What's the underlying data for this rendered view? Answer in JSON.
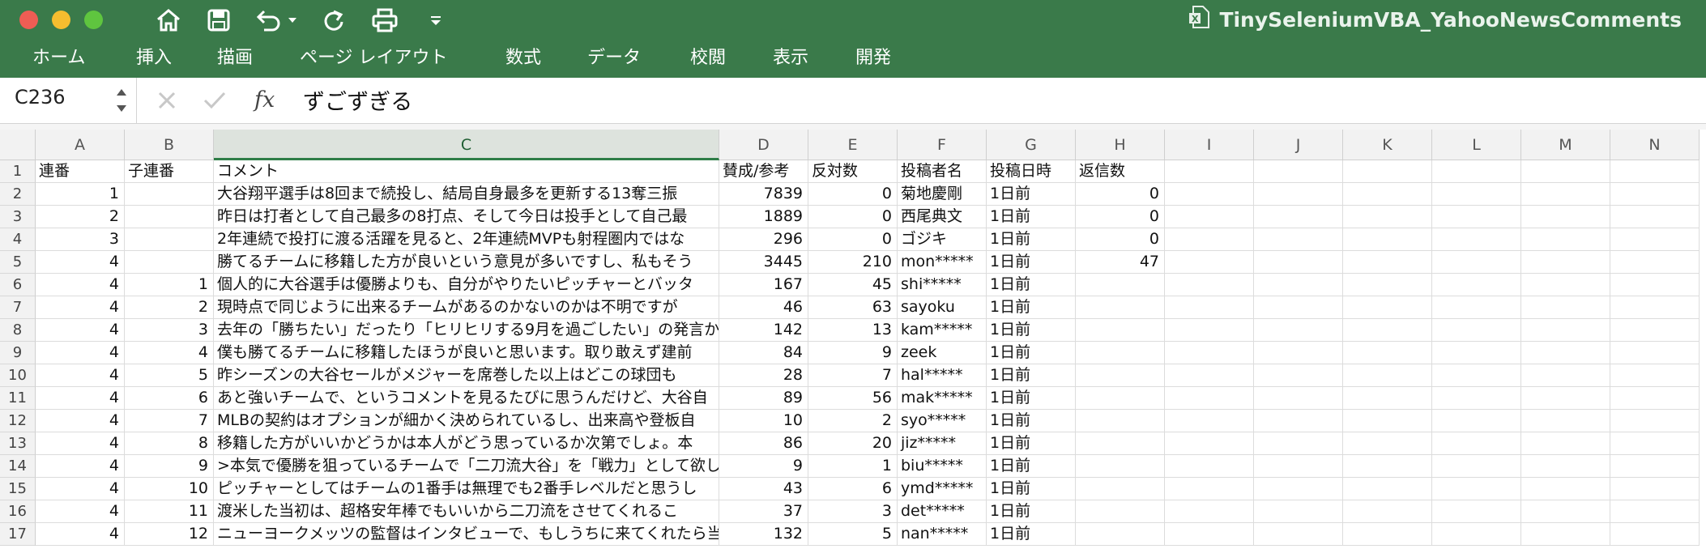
{
  "window": {
    "title": "TinySeleniumVBA_YahooNewsComments"
  },
  "colors": {
    "titlebar": "#3a7a4a",
    "close": "#ee5d54",
    "minimize": "#f5bd2f",
    "zoom": "#5fc53f",
    "selected_header": "#2e7d47"
  },
  "toolbar_icons": [
    "home-icon",
    "save-icon",
    "undo-icon",
    "redo-icon",
    "print-icon",
    "customize-dropdown-icon"
  ],
  "ribbon": {
    "tabs": [
      "ホーム",
      "挿入",
      "描画",
      "ページ レイアウト",
      "数式",
      "データ",
      "校閲",
      "表示",
      "開発"
    ]
  },
  "formula_bar": {
    "cell_ref": "C236",
    "fx": "fx",
    "content": "ずごずぎる"
  },
  "sheet": {
    "columns": [
      "A",
      "B",
      "C",
      "D",
      "E",
      "F",
      "G",
      "H",
      "I",
      "J",
      "K",
      "L",
      "M",
      "N"
    ],
    "selected_column": "C",
    "header_row": [
      "連番",
      "子連番",
      "コメント",
      "賛成/参考",
      "反対数",
      "投稿者名",
      "投稿日時",
      "返信数"
    ],
    "rows": [
      {
        "n": "2",
        "a": "1",
        "b": "",
        "c": "大谷翔平選手は8回まで続投し、結局自身最多を更新する13奪三振",
        "d": "7839",
        "e": "0",
        "f": "菊地慶剛",
        "g": "1日前",
        "h": "0"
      },
      {
        "n": "3",
        "a": "2",
        "b": "",
        "c": "昨日は打者として自己最多の8打点、そして今日は投手として自己最",
        "d": "1889",
        "e": "0",
        "f": "西尾典文",
        "g": "1日前",
        "h": "0"
      },
      {
        "n": "4",
        "a": "3",
        "b": "",
        "c": "2年連続で投打に渡る活躍を見ると、2年連続MVPも射程圏内ではな",
        "d": "296",
        "e": "0",
        "f": "ゴジキ",
        "g": "1日前",
        "h": "0"
      },
      {
        "n": "5",
        "a": "4",
        "b": "",
        "c": "勝てるチームに移籍した方が良いという意見が多いですし、私もそう",
        "d": "3445",
        "e": "210",
        "f": "mon*****",
        "g": "1日前",
        "h": "47"
      },
      {
        "n": "6",
        "a": "4",
        "b": "1",
        "c": "個人的に大谷選手は優勝よりも、自分がやりたいピッチャーとバッタ",
        "d": "167",
        "e": "45",
        "f": "shi*****",
        "g": "1日前",
        "h": ""
      },
      {
        "n": "7",
        "a": "4",
        "b": "2",
        "c": "現時点で同じように出来るチームがあるのかないのかは不明ですが",
        "d": "46",
        "e": "63",
        "f": "sayoku",
        "g": "1日前",
        "h": ""
      },
      {
        "n": "8",
        "a": "4",
        "b": "3",
        "c": "去年の「勝ちたい」だったり「ヒリヒリする9月を過ごしたい」の発言から",
        "d": "142",
        "e": "13",
        "f": "kam*****",
        "g": "1日前",
        "h": ""
      },
      {
        "n": "9",
        "a": "4",
        "b": "4",
        "c": "僕も勝てるチームに移籍したほうが良いと思います。取り敢えず建前",
        "d": "84",
        "e": "9",
        "f": "zeek",
        "g": "1日前",
        "h": ""
      },
      {
        "n": "10",
        "a": "4",
        "b": "5",
        "c": "昨シーズンの大谷セールがメジャーを席巻した以上はどこの球団も",
        "d": "28",
        "e": "7",
        "f": "hal*****",
        "g": "1日前",
        "h": ""
      },
      {
        "n": "11",
        "a": "4",
        "b": "6",
        "c": "あと強いチームで、というコメントを見るたびに思うんだけど、大谷自",
        "d": "89",
        "e": "56",
        "f": "mak*****",
        "g": "1日前",
        "h": ""
      },
      {
        "n": "12",
        "a": "4",
        "b": "7",
        "c": "MLBの契約はオプションが細かく決められているし、出来高や登板自",
        "d": "10",
        "e": "2",
        "f": "syo*****",
        "g": "1日前",
        "h": ""
      },
      {
        "n": "13",
        "a": "4",
        "b": "8",
        "c": "移籍した方がいいかどうかは本人がどう思っているか次第でしょ。本",
        "d": "86",
        "e": "20",
        "f": "jiz*****",
        "g": "1日前",
        "h": ""
      },
      {
        "n": "14",
        "a": "4",
        "b": "9",
        "c": ">本気で優勝を狙っているチームで「二刀流大谷」を「戦力」として欲し",
        "d": "9",
        "e": "1",
        "f": "biu*****",
        "g": "1日前",
        "h": ""
      },
      {
        "n": "15",
        "a": "4",
        "b": "10",
        "c": "ピッチャーとしてはチームの1番手は無理でも2番手レベルだと思うし",
        "d": "43",
        "e": "6",
        "f": "ymd*****",
        "g": "1日前",
        "h": ""
      },
      {
        "n": "16",
        "a": "4",
        "b": "11",
        "c": "渡米した当初は、超格安年棒でもいいから二刀流をさせてくれるこ",
        "d": "37",
        "e": "3",
        "f": "det*****",
        "g": "1日前",
        "h": ""
      },
      {
        "n": "17",
        "a": "4",
        "b": "12",
        "c": "ニューヨークメッツの監督はインタビューで、もしうちに来てくれたら当",
        "d": "132",
        "e": "5",
        "f": "nan*****",
        "g": "1日前",
        "h": ""
      }
    ]
  }
}
